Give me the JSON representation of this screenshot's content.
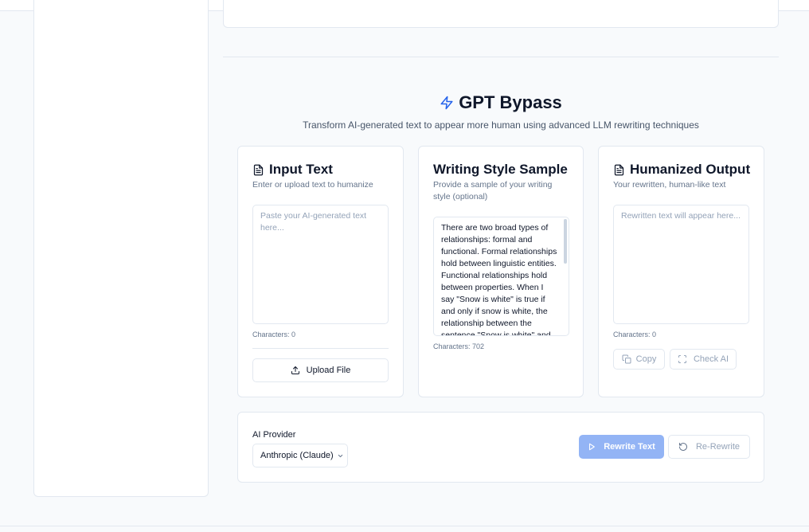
{
  "header": {
    "title": "GPT Bypass",
    "subtitle": "Transform AI-generated text to appear more human using advanced LLM rewriting techniques"
  },
  "input_card": {
    "title": "Input Text",
    "description": "Enter or upload text to humanize",
    "placeholder": "Paste your AI-generated text here...",
    "counter": "Characters: 0",
    "upload_label": "Upload File"
  },
  "style_card": {
    "title": "Writing Style Sample",
    "description": "Provide a sample of your writing style (optional)",
    "value": "There are two broad types of relationships: formal and functional. Formal relationships hold between linguistic entities. Functional relationships hold between properties. When I say \"Snow is white\" is true if and only if snow is white, the relationship between the sentence \"Snow is white\" and",
    "counter": "Characters: 702"
  },
  "output_card": {
    "title": "Humanized Output",
    "description": "Your rewritten, human-like text",
    "placeholder": "Rewritten text will appear here...",
    "counter": "Characters: 0",
    "copy_label": "Copy",
    "check_label": "Check AI"
  },
  "controls": {
    "provider_label": "AI Provider",
    "provider_value": "Anthropic (Claude)",
    "rewrite_label": "Rewrite Text",
    "rerewrite_label": "Re-Rewrite"
  },
  "colors": {
    "accent": "#2563eb",
    "primary_disabled": "#93b4f5",
    "border": "#e2e8f0",
    "muted_text": "#64748b"
  },
  "icons": {
    "title": "zap-icon",
    "card": "file-text-icon",
    "upload": "upload-icon",
    "copy": "copy-icon",
    "check": "scan-icon",
    "rewrite": "play-icon",
    "rerewrite": "rotate-ccw-icon",
    "select": "chevron-down-icon"
  }
}
